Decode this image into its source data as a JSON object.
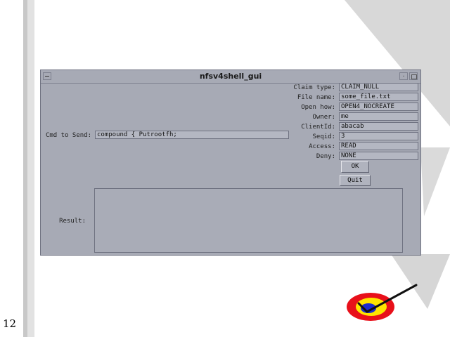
{
  "page_number": "12",
  "window": {
    "title": "nfsv4shell_gui"
  },
  "cmd": {
    "label": "Cmd to Send:",
    "value": "compound { Putrootfh;"
  },
  "params": [
    {
      "label": "Claim type:",
      "value": "CLAIM_NULL"
    },
    {
      "label": "File name:",
      "value": "some_file.txt"
    },
    {
      "label": "Open how:",
      "value": "OPEN4_NOCREATE"
    },
    {
      "label": "Owner:",
      "value": "me"
    },
    {
      "label": "ClientId:",
      "value": "abacab"
    },
    {
      "label": "Seqid:",
      "value": "3"
    },
    {
      "label": "Access:",
      "value": "READ"
    },
    {
      "label": "Deny:",
      "value": "NONE"
    }
  ],
  "buttons": {
    "ok": "OK",
    "quit": "Quit"
  },
  "result": {
    "label": "Result:",
    "value": ""
  },
  "colors": {
    "window_bg": "#a7aab5",
    "field_bg": "#b4b7c2",
    "logo_red": "#e8101a",
    "logo_yellow": "#ffe400",
    "logo_blue": "#1a2bd0"
  },
  "icons": [
    "window-menu-icon",
    "minimize-icon",
    "maximize-icon",
    "checkmark-logo-icon"
  ]
}
